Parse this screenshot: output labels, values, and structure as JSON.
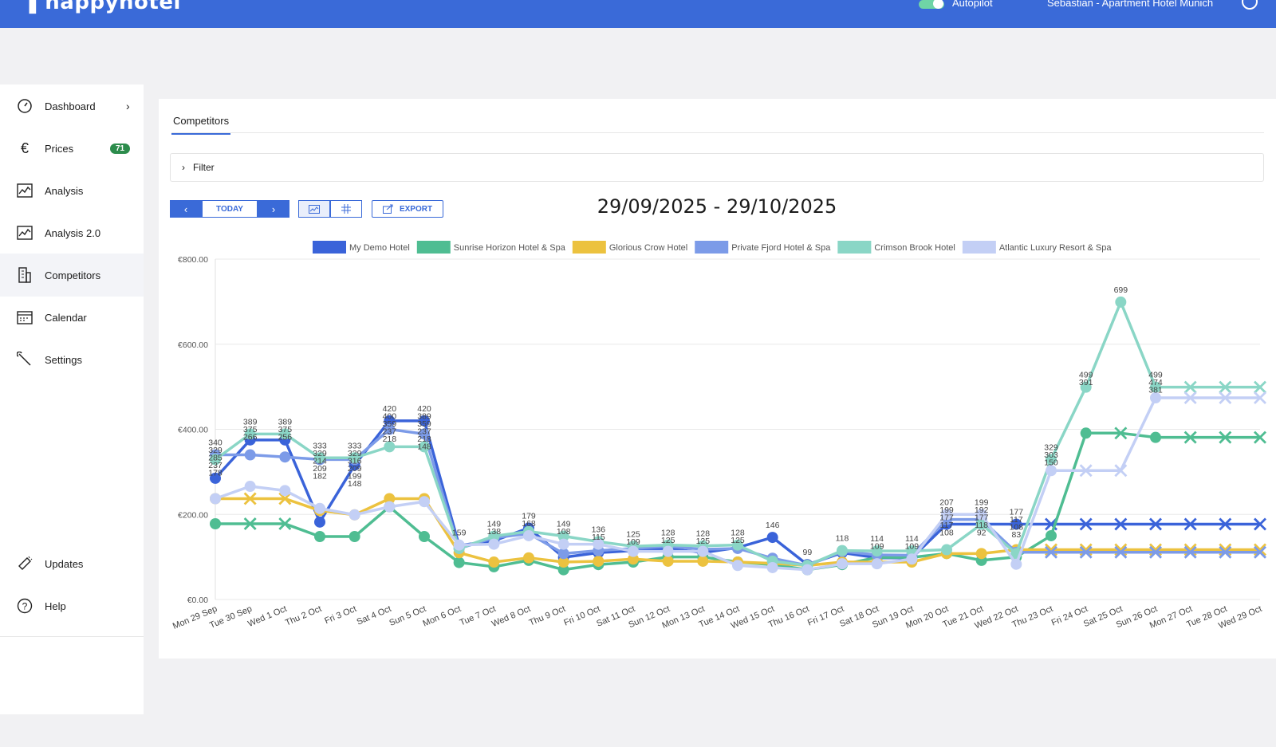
{
  "topbar": {
    "logo": "happyhotel",
    "autopilot_label": "Autopilot",
    "user_label": "Sebastian - Apartment Hotel Munich"
  },
  "sidebar": {
    "items": [
      {
        "label": "Dashboard",
        "icon": "gauge-icon"
      },
      {
        "label": "Prices",
        "icon": "euro-icon",
        "badge": "71"
      },
      {
        "label": "Analysis",
        "icon": "chart-icon"
      },
      {
        "label": "Analysis 2.0",
        "icon": "chart-icon"
      },
      {
        "label": "Competitors",
        "icon": "building-icon"
      },
      {
        "label": "Calendar",
        "icon": "calendar-icon"
      },
      {
        "label": "Settings",
        "icon": "wrench-icon"
      }
    ],
    "bottom": [
      {
        "label": "Updates",
        "icon": "megaphone-icon"
      },
      {
        "label": "Help",
        "icon": "help-icon"
      }
    ]
  },
  "main": {
    "tab": "Competitors",
    "filter_label": "Filter",
    "today_label": "TODAY",
    "export_label": "EXPORT",
    "date_range": "29/09/2025 - 29/10/2025"
  },
  "colors": {
    "brand": "#3a6ad8",
    "badge": "#2c8c4c"
  },
  "chart_data": {
    "type": "line",
    "categories": [
      "Mon 29 Sep",
      "Tue 30 Sep",
      "Wed 1 Oct",
      "Thu 2 Oct",
      "Fri 3 Oct",
      "Sat 4 Oct",
      "Sun 5 Oct",
      "Mon 6 Oct",
      "Tue 7 Oct",
      "Wed 8 Oct",
      "Thu 9 Oct",
      "Fri 10 Oct",
      "Sat 11 Oct",
      "Sun 12 Oct",
      "Mon 13 Oct",
      "Tue 14 Oct",
      "Wed 15 Oct",
      "Thu 16 Oct",
      "Fri 17 Oct",
      "Sat 18 Oct",
      "Sun 19 Oct",
      "Mon 20 Oct",
      "Tue 21 Oct",
      "Wed 22 Oct",
      "Thu 23 Oct",
      "Fri 24 Oct",
      "Sat 25 Oct",
      "Sun 26 Oct",
      "Mon 27 Oct",
      "Tue 28 Oct",
      "Wed 29 Oct"
    ],
    "yticks": [
      "€0.00",
      "€200.00",
      "€400.00",
      "€600.00",
      "€800.00"
    ],
    "ylim": [
      0,
      800
    ],
    "grid": true,
    "legend_position": "top",
    "series": [
      {
        "name": "My Demo Hotel",
        "color": "#3a63d9",
        "values": [
          285,
          375,
          375,
          182,
          316,
          420,
          420,
          127,
          138,
          168,
          99,
          110,
          115,
          120,
          110,
          122,
          146,
          82,
          110,
          98,
          98,
          177,
          177,
          177,
          177,
          177,
          177,
          177,
          177,
          177,
          177
        ],
        "missing": [
          false,
          false,
          false,
          false,
          false,
          false,
          false,
          false,
          false,
          false,
          false,
          false,
          false,
          false,
          false,
          false,
          false,
          false,
          false,
          false,
          false,
          false,
          false,
          false,
          true,
          true,
          true,
          true,
          true,
          true,
          true
        ]
      },
      {
        "name": "Sunrise Horizon Hotel & Spa",
        "color": "#4fbd92",
        "values": [
          178,
          178,
          178,
          148,
          148,
          218,
          148,
          87,
          77,
          92,
          70,
          82,
          88,
          100,
          100,
          88,
          82,
          70,
          82,
          99,
          99,
          108,
          92,
          100,
          150,
          391,
          391,
          381,
          381,
          381,
          381
        ],
        "missing": [
          false,
          true,
          true,
          false,
          false,
          false,
          false,
          false,
          false,
          false,
          false,
          false,
          false,
          false,
          false,
          false,
          false,
          false,
          false,
          false,
          false,
          false,
          false,
          false,
          false,
          false,
          true,
          false,
          true,
          true,
          true
        ]
      },
      {
        "name": "Glorious Crow Hotel",
        "color": "#ecc23f",
        "values": [
          237,
          237,
          237,
          209,
          199,
          237,
          237,
          110,
          88,
          98,
          88,
          90,
          95,
          90,
          90,
          88,
          85,
          80,
          88,
          88,
          88,
          108,
          108,
          117,
          117,
          117,
          117,
          117,
          117,
          117,
          117
        ],
        "missing": [
          false,
          true,
          true,
          false,
          false,
          false,
          false,
          false,
          false,
          false,
          false,
          false,
          false,
          false,
          false,
          false,
          false,
          false,
          false,
          false,
          false,
          false,
          false,
          false,
          true,
          true,
          true,
          true,
          true,
          true,
          true
        ]
      },
      {
        "name": "Private Fjord Hotel & Spa",
        "color": "#7c9be8",
        "values": [
          340,
          340,
          335,
          329,
          329,
          400,
          389,
          120,
          145,
          155,
          108,
          115,
          120,
          125,
          118,
          120,
          97,
          80,
          113,
          105,
          104,
          188,
          188,
          111,
          111,
          111,
          111,
          111,
          111,
          111,
          111
        ],
        "missing": [
          false,
          false,
          false,
          false,
          false,
          false,
          false,
          false,
          false,
          false,
          false,
          false,
          false,
          false,
          false,
          false,
          false,
          false,
          false,
          false,
          false,
          false,
          false,
          false,
          true,
          true,
          true,
          true,
          true,
          true,
          true
        ]
      },
      {
        "name": "Crimson Brook Hotel",
        "color": "#8ad6c6",
        "values": [
          329,
          389,
          389,
          333,
          333,
          359,
          359,
          120,
          149,
          160,
          149,
          136,
          125,
          128,
          126,
          128,
          90,
          80,
          115,
          114,
          114,
          117,
          177,
          108,
          329,
          499,
          699,
          499,
          499,
          499,
          499
        ],
        "missing": [
          false,
          false,
          false,
          false,
          false,
          false,
          false,
          false,
          false,
          false,
          false,
          false,
          false,
          false,
          false,
          false,
          false,
          false,
          false,
          false,
          false,
          false,
          false,
          false,
          false,
          false,
          false,
          false,
          true,
          true,
          true
        ]
      },
      {
        "name": "Atlantic Luxury Resort & Spa",
        "color": "#c3cff5",
        "values": [
          237,
          266,
          256,
          214,
          199,
          218,
          230,
          128,
          130,
          150,
          130,
          130,
          113,
          113,
          113,
          80,
          75,
          70,
          84,
          84,
          95,
          200,
          200,
          83,
          303,
          303,
          303,
          474,
          474,
          474,
          474
        ],
        "missing": [
          false,
          false,
          false,
          false,
          false,
          false,
          false,
          false,
          false,
          false,
          false,
          false,
          false,
          false,
          false,
          false,
          false,
          false,
          false,
          false,
          false,
          false,
          false,
          false,
          false,
          true,
          true,
          false,
          true,
          true,
          true
        ]
      }
    ],
    "data_labels": [
      {
        "x": 0,
        "value": "340"
      },
      {
        "x": 0,
        "value": "329"
      },
      {
        "x": 0,
        "value": "285"
      },
      {
        "x": 0,
        "value": "237"
      },
      {
        "x": 0,
        "value": "178"
      },
      {
        "x": 1,
        "value": "389"
      },
      {
        "x": 1,
        "value": "375"
      },
      {
        "x": 1,
        "value": "266"
      },
      {
        "x": 2,
        "value": "389"
      },
      {
        "x": 2,
        "value": "375"
      },
      {
        "x": 2,
        "value": "256"
      },
      {
        "x": 3,
        "value": "333"
      },
      {
        "x": 3,
        "value": "329"
      },
      {
        "x": 3,
        "value": "214"
      },
      {
        "x": 3,
        "value": "209"
      },
      {
        "x": 3,
        "value": "182"
      },
      {
        "x": 4,
        "value": "333"
      },
      {
        "x": 4,
        "value": "329"
      },
      {
        "x": 4,
        "value": "316"
      },
      {
        "x": 4,
        "value": "209"
      },
      {
        "x": 4,
        "value": "199"
      },
      {
        "x": 4,
        "value": "148"
      },
      {
        "x": 5,
        "value": "420"
      },
      {
        "x": 5,
        "value": "400"
      },
      {
        "x": 5,
        "value": "359"
      },
      {
        "x": 5,
        "value": "237"
      },
      {
        "x": 5,
        "value": "218"
      },
      {
        "x": 6,
        "value": "420"
      },
      {
        "x": 6,
        "value": "389"
      },
      {
        "x": 6,
        "value": "359"
      },
      {
        "x": 6,
        "value": "237"
      },
      {
        "x": 6,
        "value": "218"
      },
      {
        "x": 6,
        "value": "148"
      },
      {
        "x": 7,
        "value": "159"
      },
      {
        "x": 8,
        "value": "149"
      },
      {
        "x": 8,
        "value": "138"
      },
      {
        "x": 9,
        "value": "179"
      },
      {
        "x": 9,
        "value": "168"
      },
      {
        "x": 10,
        "value": "149"
      },
      {
        "x": 10,
        "value": "108"
      },
      {
        "x": 11,
        "value": "136"
      },
      {
        "x": 11,
        "value": "115"
      },
      {
        "x": 12,
        "value": "125"
      },
      {
        "x": 12,
        "value": "109"
      },
      {
        "x": 13,
        "value": "128"
      },
      {
        "x": 13,
        "value": "125"
      },
      {
        "x": 14,
        "value": "128"
      },
      {
        "x": 14,
        "value": "125"
      },
      {
        "x": 15,
        "value": "128"
      },
      {
        "x": 15,
        "value": "125"
      },
      {
        "x": 16,
        "value": "146"
      },
      {
        "x": 17,
        "value": "99"
      },
      {
        "x": 18,
        "value": "118"
      },
      {
        "x": 19,
        "value": "114"
      },
      {
        "x": 19,
        "value": "109"
      },
      {
        "x": 20,
        "value": "114"
      },
      {
        "x": 20,
        "value": "109"
      },
      {
        "x": 21,
        "value": "207"
      },
      {
        "x": 21,
        "value": "199"
      },
      {
        "x": 21,
        "value": "177"
      },
      {
        "x": 21,
        "value": "117"
      },
      {
        "x": 21,
        "value": "108"
      },
      {
        "x": 22,
        "value": "199"
      },
      {
        "x": 22,
        "value": "192"
      },
      {
        "x": 22,
        "value": "177"
      },
      {
        "x": 22,
        "value": "118"
      },
      {
        "x": 22,
        "value": "92"
      },
      {
        "x": 23,
        "value": "177"
      },
      {
        "x": 23,
        "value": "117"
      },
      {
        "x": 23,
        "value": "108"
      },
      {
        "x": 23,
        "value": "83"
      },
      {
        "x": 24,
        "value": "329"
      },
      {
        "x": 24,
        "value": "303"
      },
      {
        "x": 24,
        "value": "150"
      },
      {
        "x": 25,
        "value": "499"
      },
      {
        "x": 25,
        "value": "391"
      },
      {
        "x": 26,
        "value": "699"
      },
      {
        "x": 27,
        "value": "499"
      },
      {
        "x": 27,
        "value": "474"
      },
      {
        "x": 27,
        "value": "381"
      }
    ]
  }
}
